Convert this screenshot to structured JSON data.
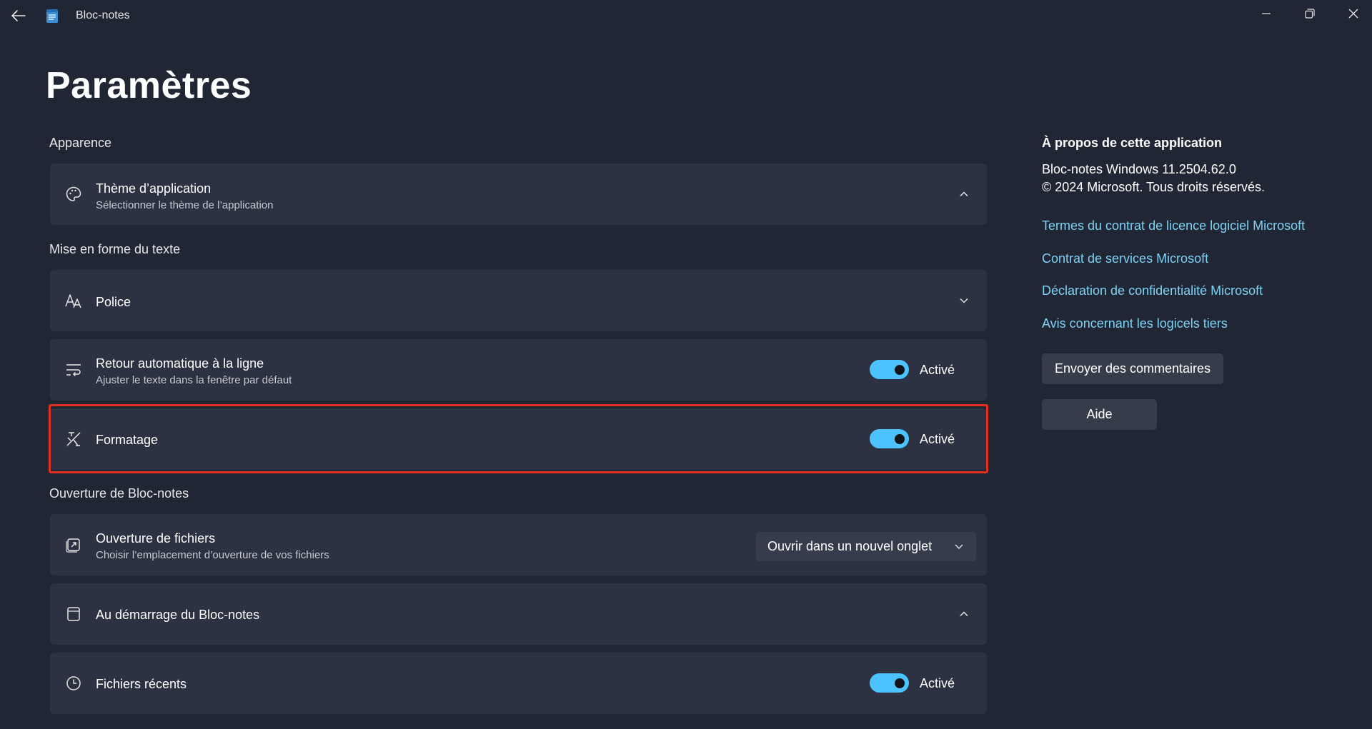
{
  "titlebar": {
    "app_name": "Bloc-notes",
    "back_icon": "back-arrow-icon",
    "app_icon": "notepad-icon",
    "minimize_icon": "minimize-icon",
    "restore_icon": "restore-icon",
    "close_icon": "close-icon"
  },
  "page": {
    "title": "Paramètres"
  },
  "sections": {
    "appearance": "Apparence",
    "text_formatting": "Mise en forme du texte",
    "opening": "Ouverture de Bloc-notes"
  },
  "settings": {
    "theme": {
      "title": "Thème d’application",
      "description": "Sélectionner le thème de l’application",
      "icon": "palette-icon",
      "expanded": true
    },
    "font": {
      "title": "Police",
      "icon": "font-icon",
      "expanded": false
    },
    "word_wrap": {
      "title": "Retour automatique à la ligne",
      "description": "Ajuster le texte dans la fenêtre par défaut",
      "icon": "word-wrap-icon",
      "state_label": "Activé",
      "on": true
    },
    "formatting": {
      "title": "Formatage",
      "icon": "formatting-icon",
      "state_label": "Activé",
      "on": true
    },
    "file_opening": {
      "title": "Ouverture de fichiers",
      "description": "Choisir l’emplacement d’ouverture de vos fichiers",
      "icon": "open-file-icon",
      "selected_option": "Ouvrir dans un nouvel onglet"
    },
    "startup": {
      "title": "Au démarrage du Bloc-notes",
      "icon": "startup-icon",
      "expanded": true
    },
    "recent_files": {
      "title": "Fichiers récents",
      "icon": "clock-icon",
      "state_label": "Activé",
      "on": true
    }
  },
  "about": {
    "title": "À propos de cette application",
    "version": "Bloc-notes Windows 11.2504.62.0",
    "copyright": "© 2024 Microsoft. Tous droits réservés.",
    "links": [
      "Termes du contrat de licence logiciel Microsoft",
      "Contrat de services Microsoft",
      "Déclaration de confidentialité Microsoft",
      "Avis concernant les logicels tiers"
    ],
    "feedback_button": "Envoyer des commentaires",
    "help_button": "Aide"
  },
  "colors": {
    "background": "#202634",
    "card": "#2c3241",
    "accent": "#4cc2ff",
    "link": "#7ed3f5",
    "highlight": "#e0301e"
  }
}
